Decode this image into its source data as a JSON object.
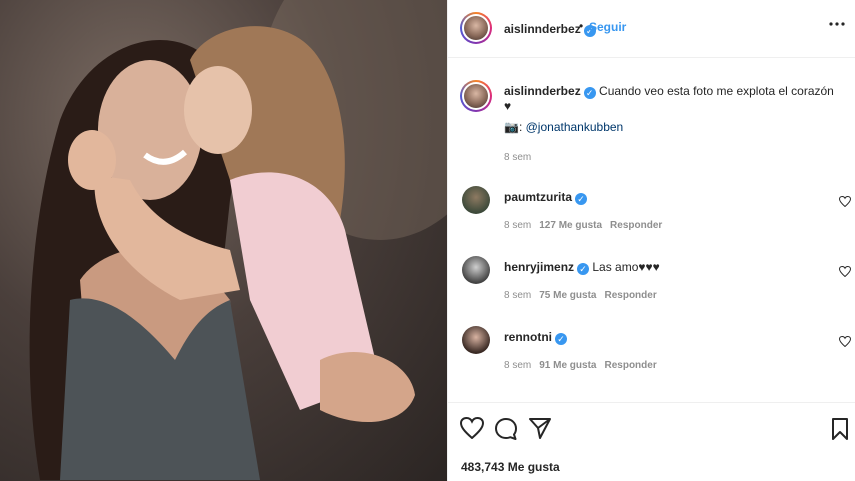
{
  "colors": {
    "verified": "#3897f0",
    "follow": "#3897f0",
    "muted": "#8e8e8e"
  },
  "header": {
    "username": "aislinnderbez",
    "separator": "•",
    "follow_label": "Seguir"
  },
  "caption": {
    "username": "aislinnderbez",
    "text": "Cuando veo esta foto me explota el corazón ♥",
    "credit_prefix": "📷:",
    "credit_handle": "@jonathankubben",
    "time": "8 sem"
  },
  "comments": [
    {
      "username": "paumtzurita",
      "text": "",
      "time": "8 sem",
      "likes": "127 Me gusta",
      "reply": "Responder"
    },
    {
      "username": "henryjimenz",
      "text": "Las amo♥♥♥",
      "time": "8 sem",
      "likes": "75 Me gusta",
      "reply": "Responder"
    },
    {
      "username": "rennotni",
      "text": "",
      "time": "8 sem",
      "likes": "91 Me gusta",
      "reply": "Responder"
    }
  ],
  "likes_text": "483,743 Me gusta",
  "icons": {
    "like": "heart-icon",
    "comment": "comment-icon",
    "share": "share-icon",
    "save": "bookmark-icon",
    "more": "more-icon"
  }
}
